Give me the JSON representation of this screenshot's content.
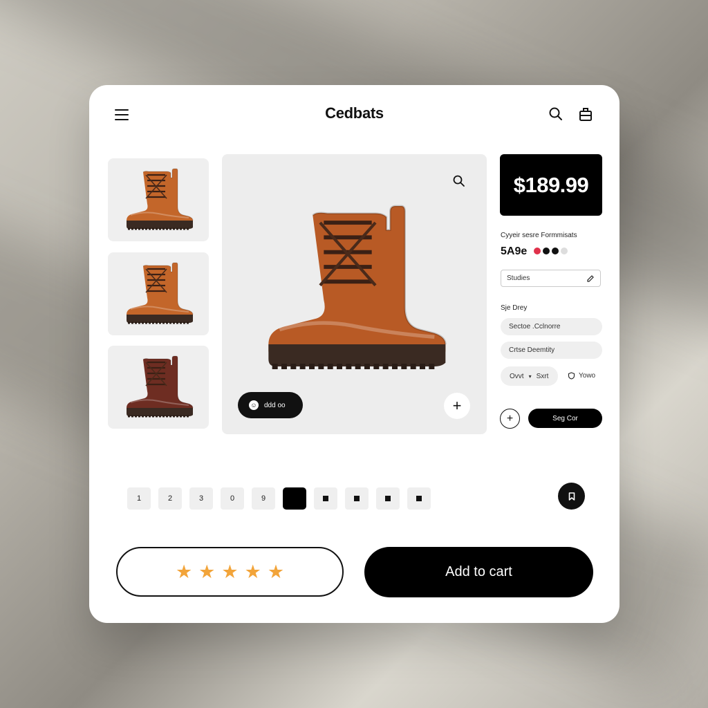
{
  "header": {
    "brand": "Cedbats",
    "icons": [
      "menu-icon",
      "search-icon",
      "bag-icon"
    ]
  },
  "gallery": {
    "thumbnails": [
      {
        "color": "#c3662a"
      },
      {
        "color": "#c3662a"
      },
      {
        "color": "#6e2d22"
      }
    ],
    "main_color": "#b85a25",
    "badge_label": "ddd oo",
    "badge_icon": "☺"
  },
  "product": {
    "price": "$189.99",
    "subtitle": "Cyyeir sesre Formmisats",
    "size_label": "5A9e",
    "swatches": [
      "#e0314b",
      "#111111",
      "#111111",
      "#dddddd"
    ],
    "studies_field": "Studies",
    "size_heading": "Sje Drey",
    "option_1": "Sectoe .Cclnorre",
    "option_2": "Crtse Deemtity",
    "option_3_a": "Ovvt",
    "option_3_b": "Sxrt",
    "link_label": "Yowo",
    "secondary_button": "Seg Cor"
  },
  "pager": {
    "items": [
      "1",
      "2",
      "3",
      "0",
      "9"
    ],
    "active_index": 5,
    "square_count": 4
  },
  "rating": {
    "stars": 5,
    "star_color": "#f2a43a"
  },
  "cta": {
    "add_to_cart": "Add to cart"
  }
}
